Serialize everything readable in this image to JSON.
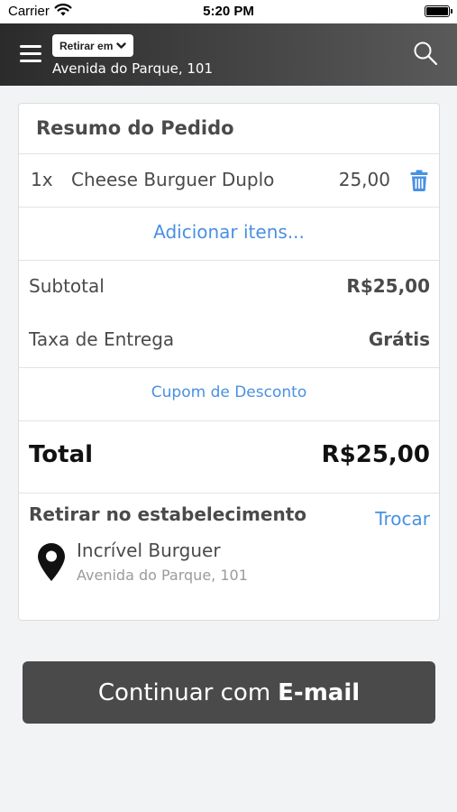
{
  "status_bar": {
    "carrier": "Carrier",
    "time": "5:20 PM"
  },
  "header": {
    "mode": "Retirar em",
    "address": "Avenida do Parque, 101"
  },
  "order": {
    "title": "Resumo do Pedido",
    "items": [
      {
        "qty": "1x",
        "name": "Cheese Burguer Duplo",
        "price": "25,00"
      }
    ],
    "add_items": "Adicionar itens...",
    "subtotal_label": "Subtotal",
    "subtotal_value": "R$25,00",
    "fee_label": "Taxa de Entrega",
    "fee_value": "Grátis",
    "coupon": "Cupom de Desconto",
    "total_label": "Total",
    "total_value": "R$25,00"
  },
  "pickup": {
    "title": "Retirar no estabelecimento",
    "change": "Trocar",
    "store_name": "Incrível Burguer",
    "store_address": "Avenida do Parque, 101"
  },
  "continue_button": {
    "prefix": "Continuar com",
    "bold": "E-mail"
  },
  "colors": {
    "accent": "#4a90e2",
    "header": "#3a3a3a",
    "button": "#4a4a4a",
    "background": "#f2f3f5"
  },
  "icons": [
    "wifi-icon",
    "battery-icon",
    "menu-icon",
    "chevron-down-icon",
    "search-icon",
    "trash-icon",
    "map-pin-icon"
  ]
}
